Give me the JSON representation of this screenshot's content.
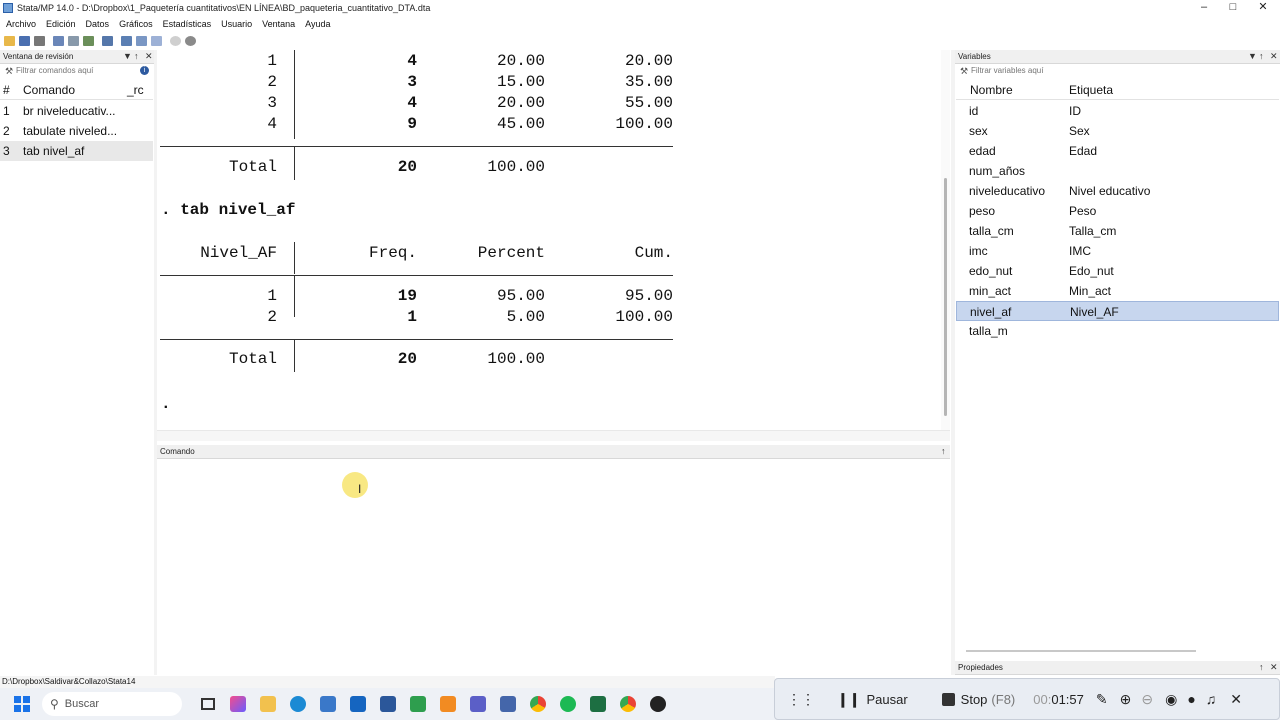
{
  "window": {
    "title": "Stata/MP 14.0 - D:\\Dropbox\\1_Paquetería cuantitativos\\EN LÍNEA\\BD_paqueteria_cuantitativo_DTA.dta"
  },
  "menu": [
    "Archivo",
    "Edición",
    "Datos",
    "Gráficos",
    "Estadísticas",
    "Usuario",
    "Ventana",
    "Ayuda"
  ],
  "review": {
    "title": "Ventana de revisión",
    "filter_placeholder": "Filtrar comandos aquí",
    "col_hash": "#",
    "col_command": "Comando",
    "col_rc": "_rc",
    "items": [
      {
        "num": "1",
        "cmd": "br niveleducativ..."
      },
      {
        "num": "2",
        "cmd": "tabulate niveled..."
      },
      {
        "num": "3",
        "cmd": "tab nivel_af"
      }
    ]
  },
  "results": {
    "table1_rows": [
      {
        "v": "1",
        "f": "4",
        "p": "20.00",
        "c": "20.00"
      },
      {
        "v": "2",
        "f": "3",
        "p": "15.00",
        "c": "35.00"
      },
      {
        "v": "3",
        "f": "4",
        "p": "20.00",
        "c": "55.00"
      },
      {
        "v": "4",
        "f": "9",
        "p": "45.00",
        "c": "100.00"
      }
    ],
    "table1_total": {
      "label": "Total",
      "f": "20",
      "p": "100.00"
    },
    "command": ". tab nivel_af",
    "table2_header": {
      "var": "Nivel_AF",
      "f": "Freq.",
      "p": "Percent",
      "c": "Cum."
    },
    "table2_rows": [
      {
        "v": "1",
        "f": "19",
        "p": "95.00",
        "c": "95.00"
      },
      {
        "v": "2",
        "f": "1",
        "p": "5.00",
        "c": "100.00"
      }
    ],
    "table2_total": {
      "label": "Total",
      "f": "20",
      "p": "100.00"
    },
    "prompt": "."
  },
  "command_panel": {
    "title": "Comando"
  },
  "variables": {
    "title": "Variables",
    "filter_placeholder": "Filtrar variables aquí",
    "col_name": "Nombre",
    "col_label": "Etiqueta",
    "items": [
      {
        "name": "id",
        "label": "ID"
      },
      {
        "name": "sex",
        "label": "Sex"
      },
      {
        "name": "edad",
        "label": "Edad"
      },
      {
        "name": "num_años",
        "label": ""
      },
      {
        "name": "niveleducativo",
        "label": "Nivel educativo"
      },
      {
        "name": "peso",
        "label": "Peso"
      },
      {
        "name": "talla_cm",
        "label": "Talla_cm"
      },
      {
        "name": "imc",
        "label": "IMC"
      },
      {
        "name": "edo_nut",
        "label": "Edo_nut"
      },
      {
        "name": "min_act",
        "label": "Min_act"
      },
      {
        "name": "nivel_af",
        "label": "Nivel_AF"
      },
      {
        "name": "talla_m",
        "label": ""
      }
    ]
  },
  "properties": {
    "title": "Propiedades"
  },
  "statusbar": {
    "path": "D:\\Dropbox\\Saldivar&Collazo\\Stata14"
  },
  "taskbar": {
    "search_placeholder": "Buscar"
  },
  "recorder": {
    "pause_label": "Pausar",
    "stop_label": "Stop",
    "stop_key": "(F8)",
    "time_prefix": "00:",
    "time": "01:57"
  }
}
